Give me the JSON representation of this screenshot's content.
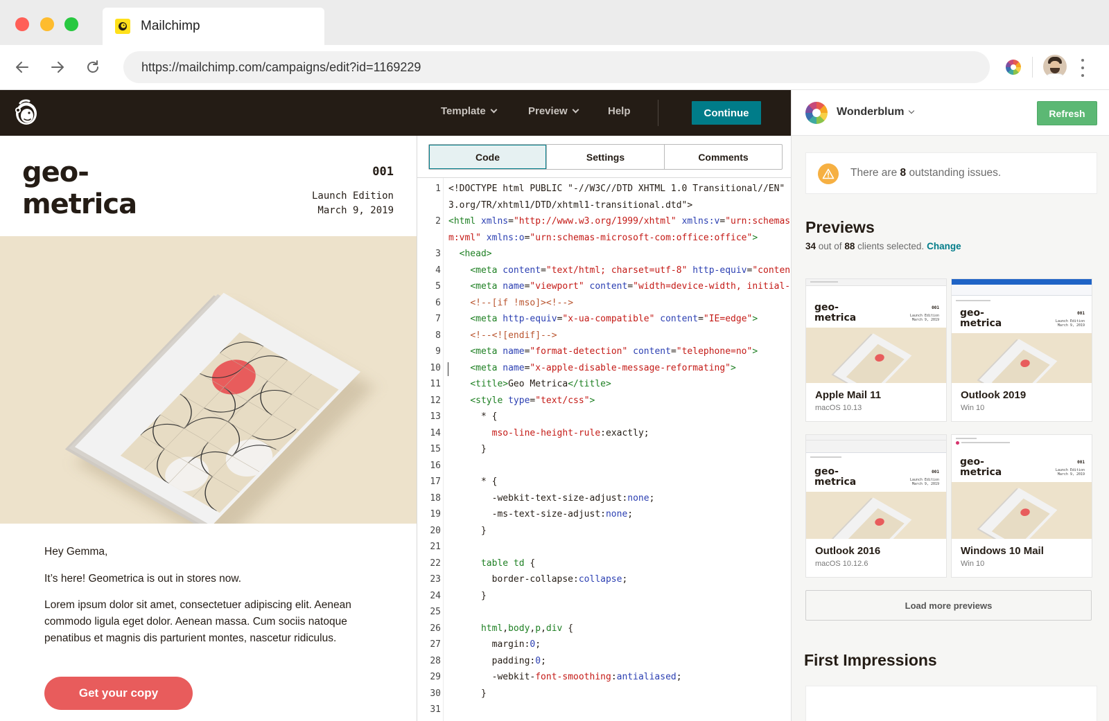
{
  "browser": {
    "tab_title": "Mailchimp",
    "url": "https://mailchimp.com/campaigns/edit?id=1169229"
  },
  "appbar": {
    "menu": [
      {
        "label": "Template",
        "has_caret": true
      },
      {
        "label": "Preview",
        "has_caret": true
      },
      {
        "label": "Help",
        "has_caret": false
      }
    ],
    "continue_label": "Continue"
  },
  "email": {
    "brand_line1": "geo-",
    "brand_line2": "metrica",
    "issue_number": "001",
    "edition": "Launch Edition",
    "date": "March 9, 2019",
    "greeting": "Hey Gemma,",
    "intro": "It’s here! Geometrica is out in stores now.",
    "paragraph": "Lorem ipsum dolor sit amet, consectetuer adipiscing elit. Aenean commodo ligula eget dolor. Aenean massa. Cum sociis natoque penatibus et magnis dis parturient montes, nascetur ridiculus.",
    "cta_label": "Get your copy",
    "accent_color": "#e85c5c",
    "hero_color": "#ede2cb"
  },
  "editor": {
    "tabs": [
      {
        "label": "Code",
        "active": true
      },
      {
        "label": "Settings",
        "active": false
      },
      {
        "label": "Comments",
        "active": false
      }
    ],
    "lines": [
      {
        "n": "1",
        "html": "&lt;!DOCTYPE html PUBLIC \"-//W3C//DTD XHTML 1.0 Transitional//EN\" \""
      },
      {
        "n": "",
        "html": "3.org/TR/xhtml1/DTD/xhtml1-transitional.dtd\"&gt;"
      },
      {
        "n": "2",
        "html": "<span class='tag'>&lt;html</span> <span class='attr'>xmlns</span>=<span class='str'>\"http://www.w3.org/1999/xhtml\"</span> <span class='attr'>xmlns:v</span>=<span class='str'>\"urn:schemas-</span>"
      },
      {
        "n": "",
        "html": "<span class='str'>m:vml\"</span> <span class='attr'>xmlns:o</span>=<span class='str'>\"urn:schemas-microsoft-com:office:office\"</span><span class='tag'>&gt;</span>"
      },
      {
        "n": "3",
        "html": "  <span class='tag'>&lt;head&gt;</span>"
      },
      {
        "n": "4",
        "html": "    <span class='tag'>&lt;meta</span> <span class='attr'>content</span>=<span class='str'>\"text/html; charset=utf-8\"</span> <span class='attr'>http-equiv</span>=<span class='str'>\"content</span>"
      },
      {
        "n": "5",
        "html": "    <span class='tag'>&lt;meta</span> <span class='attr'>name</span>=<span class='str'>\"viewport\"</span> <span class='attr'>content</span>=<span class='str'>\"width=device-width, initial-s</span>"
      },
      {
        "n": "6",
        "html": "    <span class='cmt'>&lt;!--[if !mso]&gt;&lt;!--&gt;</span>"
      },
      {
        "n": "7",
        "html": "    <span class='tag'>&lt;meta</span> <span class='attr'>http-equiv</span>=<span class='str'>\"x-ua-compatible\"</span> <span class='attr'>content</span>=<span class='str'>\"IE=edge\"</span><span class='tag'>&gt;</span>"
      },
      {
        "n": "8",
        "html": "    <span class='cmt'>&lt;!--&lt;![endif]--&gt;</span>"
      },
      {
        "n": "9",
        "html": "    <span class='tag'>&lt;meta</span> <span class='attr'>name</span>=<span class='str'>\"format-detection\"</span> <span class='attr'>content</span>=<span class='str'>\"telephone=no\"</span><span class='tag'>&gt;</span>"
      },
      {
        "n": "10",
        "html": "    <span class='tag'>&lt;meta</span> <span class='attr'>name</span>=<span class='str'>\"x-apple-disable-message-reformating\"</span><span class='tag'>&gt;</span>"
      },
      {
        "n": "11",
        "html": "    <span class='tag'>&lt;title&gt;</span>Geo Metrica<span class='tag'>&lt;/title&gt;</span>"
      },
      {
        "n": "12",
        "html": "    <span class='tag'>&lt;style</span> <span class='attr'>type</span>=<span class='str'>\"text/css\"</span><span class='tag'>&gt;</span>"
      },
      {
        "n": "13",
        "html": "      * {"
      },
      {
        "n": "14",
        "html": "        <span class='prop'>mso-line-height-rule</span>:exactly;"
      },
      {
        "n": "15",
        "html": "      }"
      },
      {
        "n": "16",
        "html": ""
      },
      {
        "n": "17",
        "html": "      * {"
      },
      {
        "n": "18",
        "html": "        -webkit-text-size-adjust:<span class='kw'>none</span>;"
      },
      {
        "n": "19",
        "html": "        -ms-text-size-adjust:<span class='kw'>none</span>;"
      },
      {
        "n": "20",
        "html": "      }"
      },
      {
        "n": "21",
        "html": ""
      },
      {
        "n": "22",
        "html": "      <span class='tag'>table td</span> {"
      },
      {
        "n": "23",
        "html": "        border-collapse:<span class='kw'>collapse</span>;"
      },
      {
        "n": "24",
        "html": "      }"
      },
      {
        "n": "25",
        "html": ""
      },
      {
        "n": "26",
        "html": "      <span class='tag'>html</span>,<span class='tag'>body</span>,<span class='tag'>p</span>,<span class='tag'>div</span> {"
      },
      {
        "n": "27",
        "html": "        margin:<span class='kw'>0</span>;"
      },
      {
        "n": "28",
        "html": "        padding:<span class='kw'>0</span>;"
      },
      {
        "n": "29",
        "html": "        -webkit-<span class='prop'>font-smoothing</span>:<span class='kw'>antialiased</span>;"
      },
      {
        "n": "30",
        "html": "      }"
      },
      {
        "n": "31",
        "html": ""
      }
    ]
  },
  "right_panel": {
    "org_name": "Wonderblum",
    "refresh_label": "Refresh",
    "issues_prefix": "There are ",
    "issues_count": "8",
    "issues_suffix": " outstanding issues.",
    "previews_title": "Previews",
    "clients_selected": "34",
    "clients_middle": " out of ",
    "clients_total": "88",
    "clients_suffix": " clients selected.",
    "change_label": "Change",
    "previews": [
      {
        "name": "Apple Mail 11",
        "platform": "macOS 10.13",
        "chrome": "mac"
      },
      {
        "name": "Outlook 2019",
        "platform": "Win 10",
        "chrome": "outlook"
      },
      {
        "name": "Outlook 2016",
        "platform": "macOS 10.12.6",
        "chrome": "outlook-mac"
      },
      {
        "name": "Windows 10 Mail",
        "platform": "Win 10",
        "chrome": "winmail"
      }
    ],
    "load_more_label": "Load more previews",
    "first_impressions_title": "First Impressions"
  }
}
